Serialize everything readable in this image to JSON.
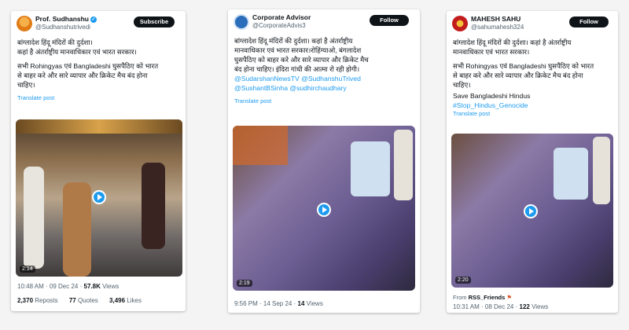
{
  "posts": [
    {
      "name": "Prof. Sudhanshu",
      "handle": "@Sudhanshutrivedi",
      "button": "Subscribe",
      "lines": [
        "बांग्लादेश हिंदू मंदिरों की दुर्दशा।",
        "कहां है अंतर्राष्ट्रीय मानवाधिकार एवं भारत सरकार।"
      ],
      "lines2": [
        "सभी Rohingyas एवं Bangladeshi घुसपैठिए को भारत",
        "से बाहर करे और सारे व्यापार और क्रिकेट मैच बंद होना",
        "चाहिए।"
      ],
      "translate": "Translate post",
      "duration": "2:14",
      "time": "10:48 AM · 09 Dec 24 · ",
      "views_count": "57.8K",
      "views_label": " Views",
      "reposts_count": "2,370",
      "reposts_label": "Reposts",
      "quotes_count": "77",
      "quotes_label": "Quotes",
      "likes_count": "3,496",
      "likes_label": "Likes"
    },
    {
      "name": "Corporate Advisor",
      "handle": "@CorporateAdvis3",
      "button": "Follow",
      "lines": [
        "बांग्लादेश हिंदू मंदिरों की दुर्दशा। कहां है अंतर्राष्ट्रीय",
        "मानवाधिकार एवं भारत सरकार।रोहिंग्याओ, बंगलादेश",
        "घुसपैठिए को बाहर करे और सारे व्यापार और क्रिकेट मैच",
        "बंद होना चाहिए। इंदिरा गांधी की आत्मा रो रही होगी।"
      ],
      "mentions": [
        "@SudarshanNewsTV @SudhanshuTrived",
        "@SushantBSinha @sudhirchaudhary"
      ],
      "translate": "Translate post",
      "duration": "2:19",
      "time": "9:56 PM · 14 Sep 24 · ",
      "views_count": "14",
      "views_label": " Views"
    },
    {
      "name": "MAHESH SAHU",
      "handle": "@sahumahesh324",
      "button": "Follow",
      "lines": [
        "बांग्लादेश हिंदू मंदिरों की दुर्दशा। कहां है अंतर्राष्ट्रीय",
        "मानवाधिकार एवं भारत सरकार।"
      ],
      "lines2": [
        "सभी Rohingyas एवं Bangladeshi घुसपैठिए को भारत",
        "से बाहर करे और सारे व्यापार और क्रिकेट मैच बंद होना",
        "चाहिए।"
      ],
      "extra": "Save Bangladeshi Hindus",
      "hashtag": "#Stop_Hindus_Genocide",
      "translate": "Translate post",
      "duration": "2:20",
      "from_label": "From ",
      "from_name": "RSS_Friends",
      "time": "10:31 AM · 08 Dec 24 · ",
      "views_count": "122",
      "views_label": " Views"
    }
  ],
  "watermark": "",
  "colors": {
    "accent": "#1d9bf0",
    "dark": "#0f1419",
    "muted": "#536471"
  }
}
